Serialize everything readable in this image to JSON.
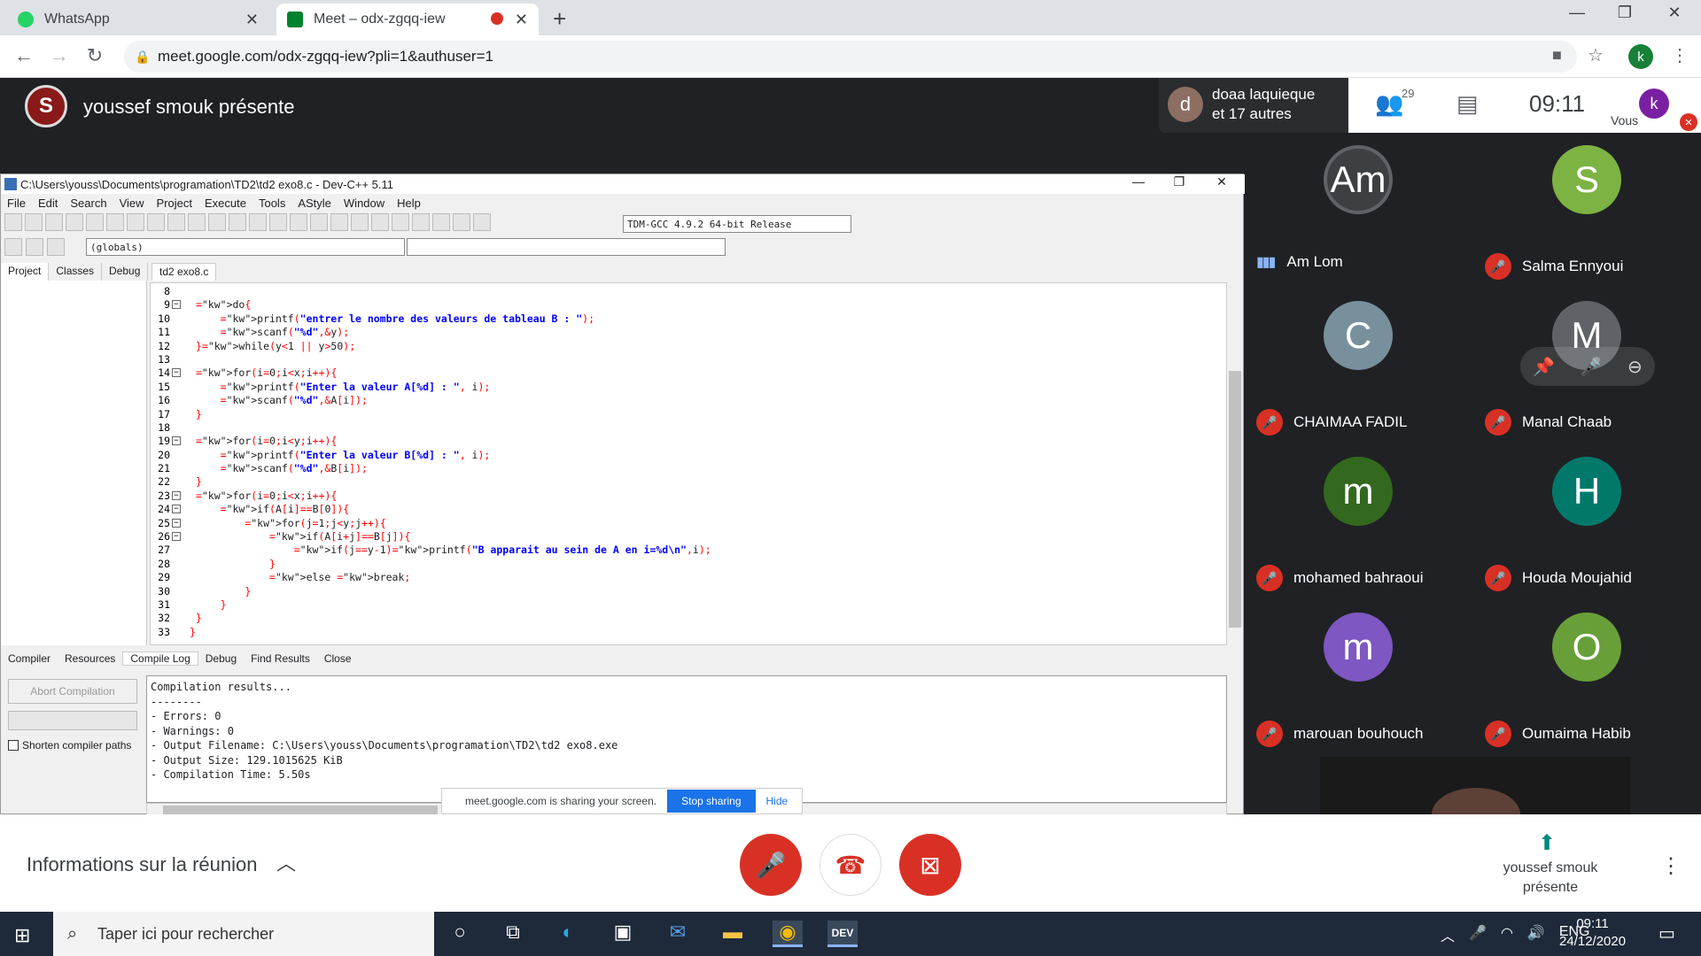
{
  "browser": {
    "tabs": [
      {
        "label": "WhatsApp",
        "icon": "whatsapp-icon"
      },
      {
        "label": "Meet – odx-zgqq-iew",
        "icon": "meet-icon"
      }
    ],
    "url": "meet.google.com/odx-zgqq-iew?pli=1&authuser=1",
    "profile_initial": "k"
  },
  "meet": {
    "presenter_title": "youssef smouk présente",
    "participants_summary_line1": "doaa laquieque",
    "participants_summary_line2": "et 17 autres",
    "participants_avatar": "d",
    "people_count": "29",
    "clock": "09:11",
    "you_label": "Vous",
    "you_initial": "k",
    "participants": [
      {
        "initial": "Am",
        "name": "Am Lom",
        "color": "#3c4043",
        "muted": false
      },
      {
        "initial": "S",
        "name": "Salma Ennyoui",
        "color": "#7cb342",
        "muted": true
      },
      {
        "initial": "C",
        "name": "CHAIMAA FADIL",
        "color": "#78909c",
        "muted": true
      },
      {
        "initial": "M",
        "name": "Manal Chaab",
        "color": "#5f6368",
        "muted": true
      },
      {
        "initial": "m",
        "name": "mohamed bahraoui",
        "color": "#33691e",
        "muted": true
      },
      {
        "initial": "H",
        "name": "Houda Moujahid",
        "color": "#00796b",
        "muted": true
      },
      {
        "initial": "m",
        "name": "marouan bouhouch",
        "color": "#7e57c2",
        "muted": true
      },
      {
        "initial": "O",
        "name": "Oumaima Habib",
        "color": "#689f38",
        "muted": true
      }
    ],
    "info_label": "Informations sur la réunion",
    "presenting_label_line1": "youssef smouk",
    "presenting_label_line2": "présente",
    "share_notice": "meet.google.com is sharing your screen.",
    "stop_sharing": "Stop sharing",
    "hide": "Hide"
  },
  "devcpp": {
    "title": "C:\\Users\\youss\\Documents\\programation\\TD2\\td2 exo8.c - Dev-C++ 5.11",
    "menu": [
      "File",
      "Edit",
      "Search",
      "View",
      "Project",
      "Execute",
      "Tools",
      "AStyle",
      "Window",
      "Help"
    ],
    "compiler": "TDM-GCC 4.9.2 64-bit Release",
    "globals": "(globals)",
    "left_tabs": [
      "Project",
      "Classes",
      "Debug"
    ],
    "editor_tab": "td2 exo8.c",
    "line_numbers": [
      "8",
      "9",
      "10",
      "11",
      "12",
      "13",
      "14",
      "15",
      "16",
      "17",
      "18",
      "19",
      "20",
      "21",
      "22",
      "23",
      "24",
      "25",
      "26",
      "27",
      "28",
      "29",
      "30",
      "31",
      "32",
      "33"
    ],
    "code_lines": [
      "",
      " do{",
      "     printf(\"entrer le nombre des valeurs de tableau B : \");",
      "     scanf(\"%d\",&y);",
      " }while(y<1 || y>50);",
      "",
      " for(i=0;i<x;i++){",
      "     printf(\"Enter la valeur A[%d] : \", i);",
      "     scanf(\"%d\",&A[i]);",
      " }",
      "",
      " for(i=0;i<y;i++){",
      "     printf(\"Enter la valeur B[%d] : \", i);",
      "     scanf(\"%d\",&B[i]);",
      " }",
      " for(i=0;i<x;i++){",
      "     if(A[i]==B[0]){",
      "         for(j=1;j<y;j++){",
      "             if(A[i+j]==B[j]){",
      "                 if(j==y-1)printf(\"B apparait au sein de A en i=%d\\n\",i);",
      "             }",
      "             else break;",
      "         }",
      "     }",
      " }",
      "}"
    ],
    "bottom_tabs": [
      "Compiler",
      "Resources",
      "Compile Log",
      "Debug",
      "Find Results",
      "Close"
    ],
    "abort_label": "Abort Compilation",
    "shorten_label": "Shorten compiler paths",
    "log": "Compilation results...\n--------\n- Errors: 0\n- Warnings: 0\n- Output Filename: C:\\Users\\youss\\Documents\\programation\\TD2\\td2 exo8.exe\n- Output Size: 129.1015625 KiB\n- Compilation Time: 5.50s"
  },
  "taskbar": {
    "search_placeholder": "Taper ici pour rechercher",
    "lang": "ENG",
    "time": "09:11",
    "date": "24/12/2020"
  }
}
